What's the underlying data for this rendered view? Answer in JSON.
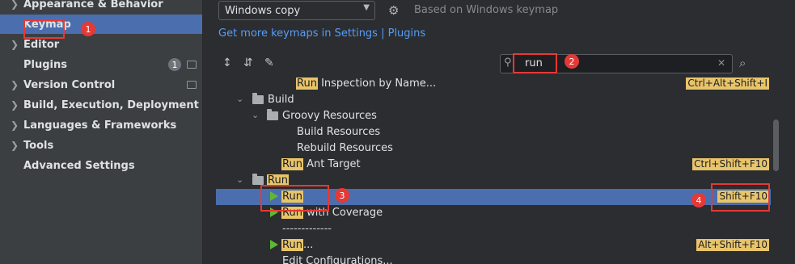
{
  "sidebar": {
    "items": [
      {
        "label": "Appearance & Behavior",
        "chevron": true
      },
      {
        "label": "Keymap",
        "chevron": false,
        "selected": true
      },
      {
        "label": "Editor",
        "chevron": true
      },
      {
        "label": "Plugins",
        "chevron": false,
        "badge": "1"
      },
      {
        "label": "Version Control",
        "chevron": true
      },
      {
        "label": "Build, Execution, Deployment",
        "chevron": true
      },
      {
        "label": "Languages & Frameworks",
        "chevron": true
      },
      {
        "label": "Tools",
        "chevron": true
      },
      {
        "label": "Advanced Settings",
        "chevron": false
      }
    ]
  },
  "keymap": {
    "selected": "Windows copy",
    "based_on": "Based on Windows keymap",
    "link": "Get more keymaps in Settings | Plugins"
  },
  "search": {
    "value": "run"
  },
  "tree": {
    "rows": [
      {
        "prefix": "Run",
        "text": " Inspection by Name...",
        "shortcut": "Ctrl+Alt+Shift+I"
      },
      {
        "text": "Build"
      },
      {
        "text": "Groovy Resources"
      },
      {
        "text": "Build Resources"
      },
      {
        "text": "Rebuild Resources"
      },
      {
        "prefix": "Run",
        "text": " Ant Target",
        "shortcut": "Ctrl+Shift+F10"
      },
      {
        "prefix": "Run",
        "text": ""
      },
      {
        "prefix": "Run",
        "text": "",
        "shortcut": "Shift+F10",
        "selected": true
      },
      {
        "prefix": "Run",
        "text": " with Coverage"
      },
      {
        "text": "-------------"
      },
      {
        "prefix": "Run",
        "text": "...",
        "shortcut": "Alt+Shift+F10"
      },
      {
        "text": "Edit Configurations..."
      }
    ]
  },
  "annotations": [
    "1",
    "2",
    "3",
    "4"
  ],
  "colors": {
    "accent": "#4b6eaf",
    "highlight": "#e8c46a",
    "annotation": "#e53935",
    "run_green": "#5fb832"
  }
}
